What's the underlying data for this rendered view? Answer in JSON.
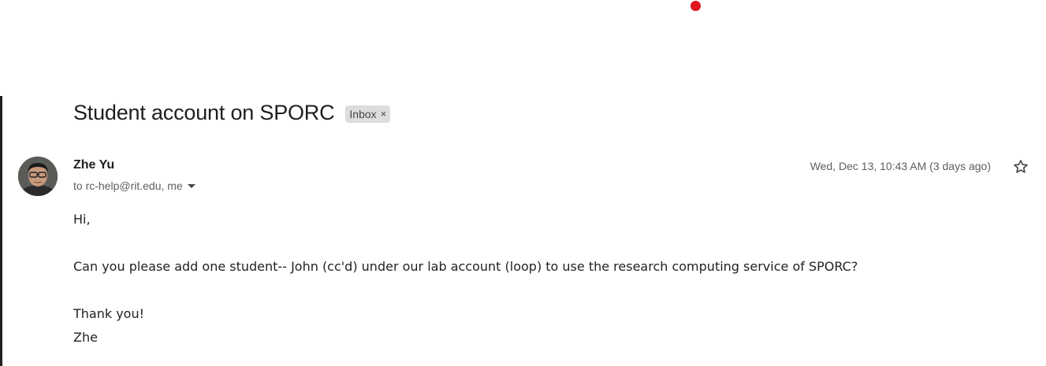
{
  "email": {
    "subject": "Student account on SPORC",
    "label": "Inbox",
    "label_remove_icon": "close-icon",
    "sender": {
      "name": "Zhe Yu",
      "avatar": "avatar-photo"
    },
    "recipients": "to rc-help@rit.edu, me",
    "details_icon": "caret-down-icon",
    "date": "Wed, Dec 13, 10:43 AM (3 days ago)",
    "star_icon": "star-outline-icon",
    "body": {
      "greeting": "Hi,",
      "message": "Can you please add one student-- John (cc'd) under our lab account (loop) to use the research computing service of SPORC?",
      "closing": "Thank you!",
      "signature": "Zhe"
    }
  },
  "colors": {
    "cursor_dot": "#e0141e",
    "label_chip_bg": "#dddddd",
    "muted_text": "#5e5e5e"
  }
}
